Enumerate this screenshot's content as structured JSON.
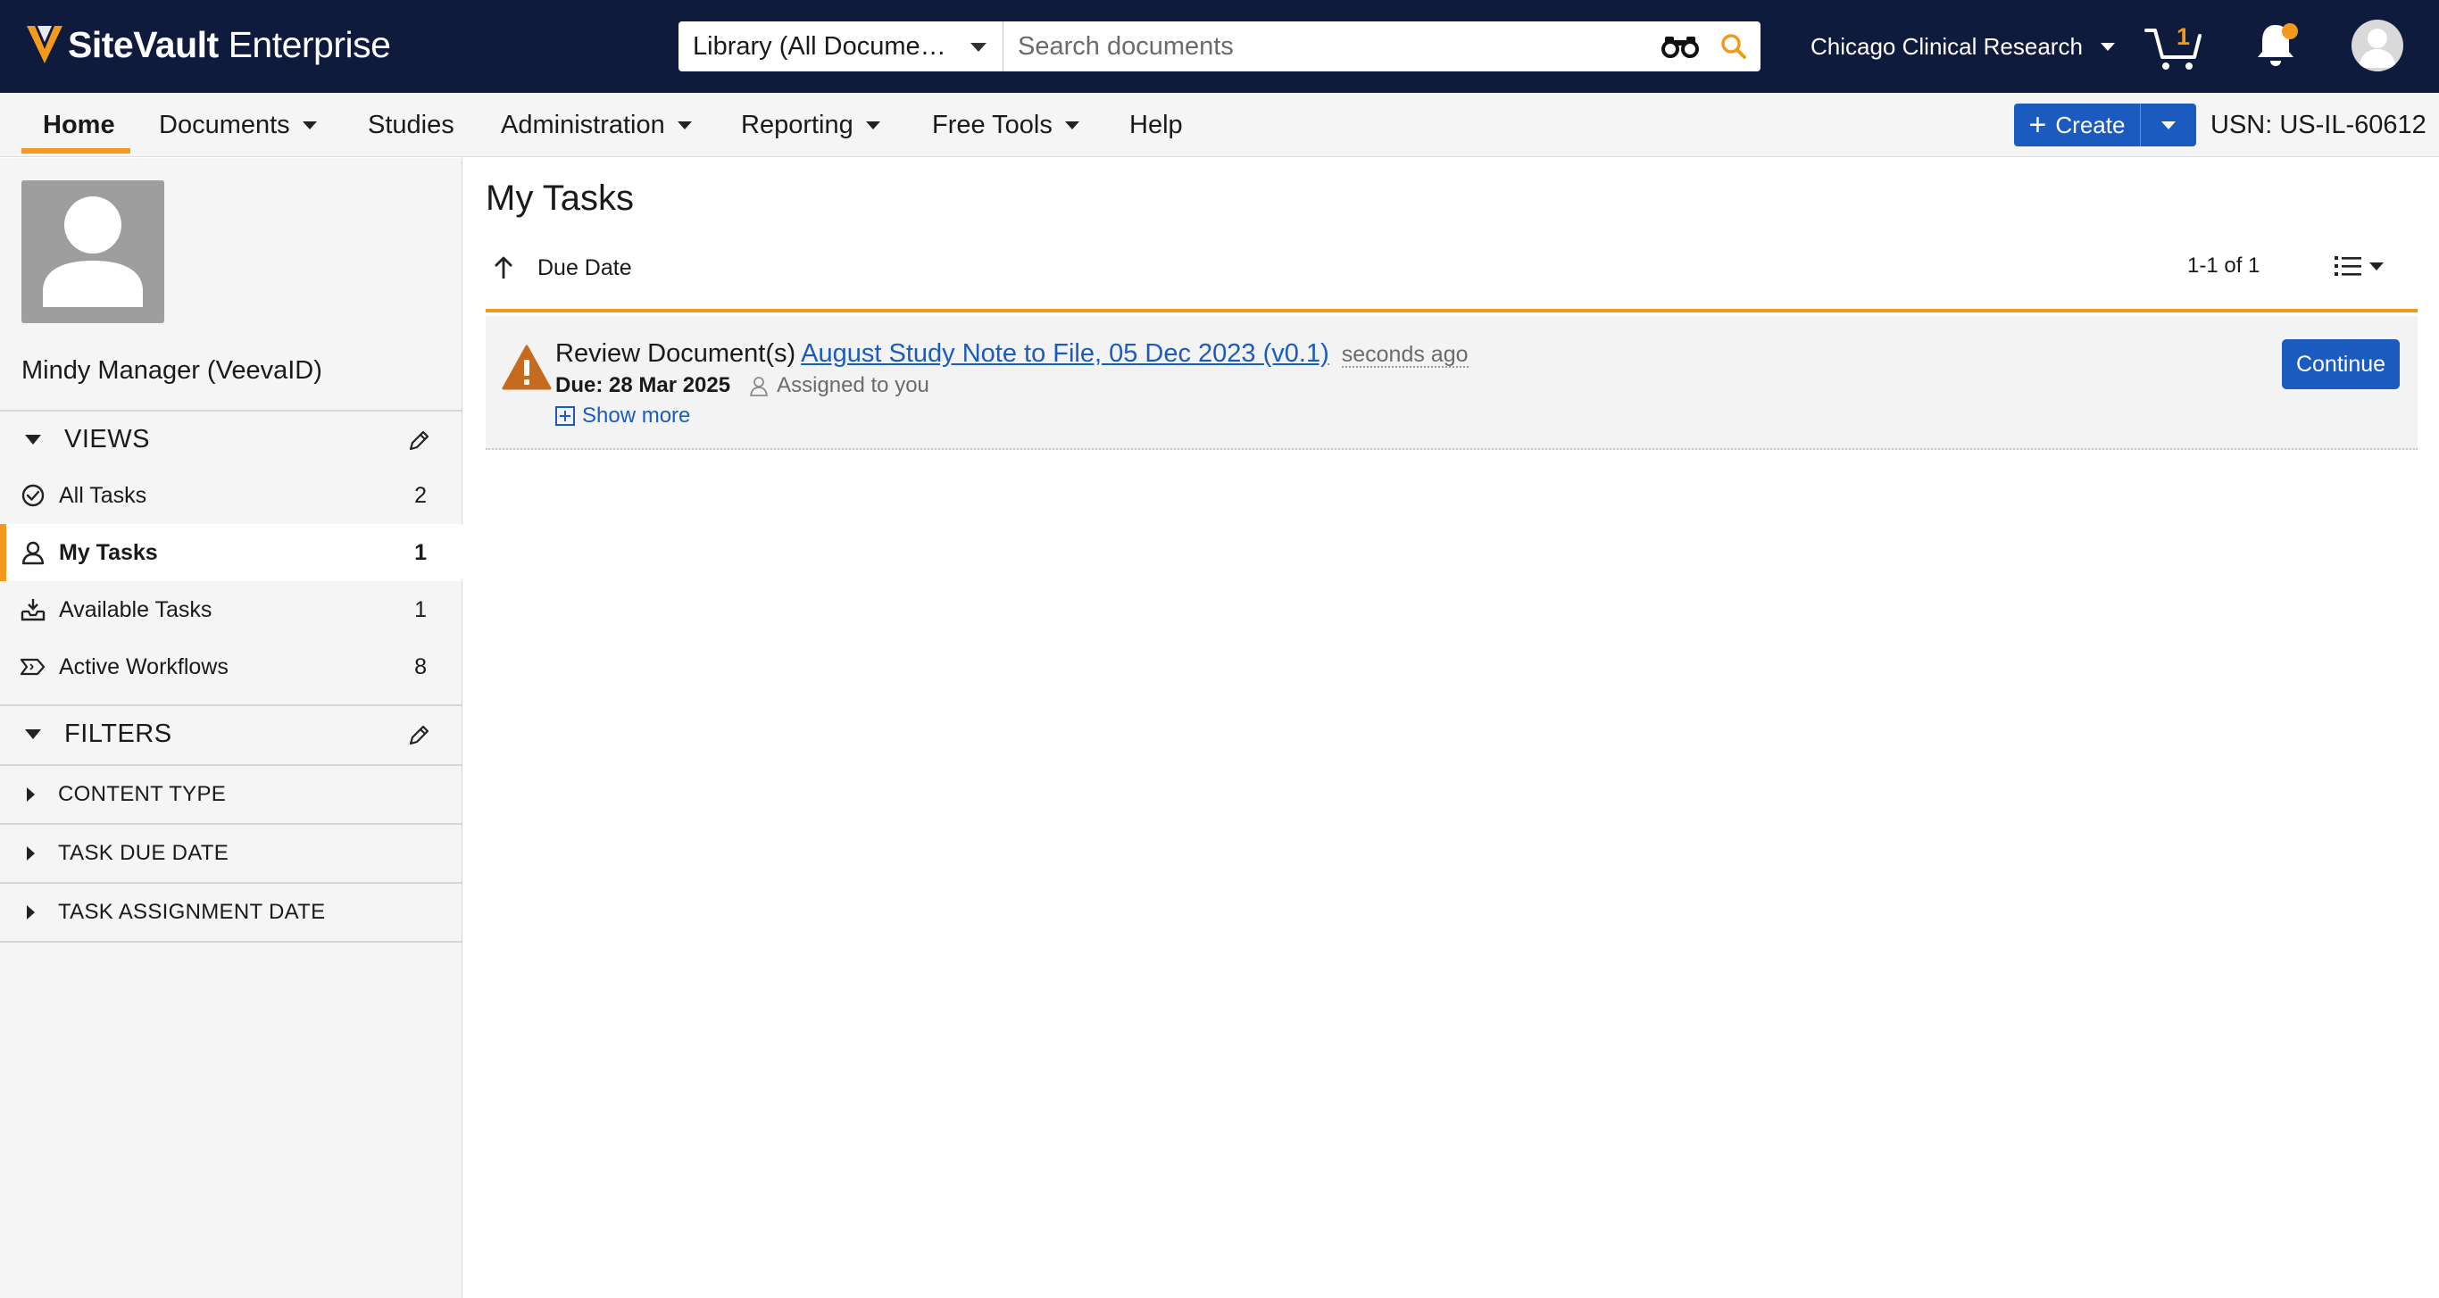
{
  "app": {
    "brand_strong": "SiteVault",
    "brand_light": " Enterprise"
  },
  "search": {
    "scope_label": "Library (All Docume…",
    "placeholder": "Search documents"
  },
  "header": {
    "site_name": "Chicago Clinical Research",
    "cart_count": "1",
    "notification_dot_color": "#f39a1e"
  },
  "nav": {
    "items": [
      {
        "label": "Home",
        "active": true,
        "dropdown": false
      },
      {
        "label": "Documents",
        "dropdown": true
      },
      {
        "label": "Studies",
        "dropdown": false
      },
      {
        "label": "Administration",
        "dropdown": true
      },
      {
        "label": "Reporting",
        "dropdown": true
      },
      {
        "label": "Free Tools",
        "dropdown": true
      },
      {
        "label": "Help",
        "dropdown": false
      }
    ],
    "create_label": "Create",
    "usn": "USN: US-IL-60612"
  },
  "sidebar": {
    "user_name": "Mindy Manager (VeevaID)",
    "views_title": "VIEWS",
    "views": [
      {
        "label": "All Tasks",
        "count": "2",
        "icon": "check-circle-icon"
      },
      {
        "label": "My Tasks",
        "count": "1",
        "icon": "person-icon",
        "active": true
      },
      {
        "label": "Available Tasks",
        "count": "1",
        "icon": "inbox-download-icon"
      },
      {
        "label": "Active Workflows",
        "count": "8",
        "icon": "workflow-icon"
      }
    ],
    "filters_title": "FILTERS",
    "filters": [
      {
        "label": "CONTENT TYPE"
      },
      {
        "label": "TASK DUE DATE"
      },
      {
        "label": "TASK ASSIGNMENT DATE"
      }
    ]
  },
  "main": {
    "title": "My Tasks",
    "sort_label": "Due Date",
    "pager": "1-1 of 1",
    "task": {
      "action": "Review Document(s)",
      "doc_link": "August Study Note to File, 05 Dec 2023 (v0.1)",
      "time": "seconds ago",
      "due": "Due: 28 Mar 2025",
      "assigned": "Assigned to you",
      "show_more": "Show more",
      "continue_label": "Continue"
    }
  },
  "colors": {
    "topbar": "#0f1b3d",
    "accent_orange": "#f39a1e",
    "primary_blue": "#1b5bbf",
    "warning": "#c56a1f"
  }
}
